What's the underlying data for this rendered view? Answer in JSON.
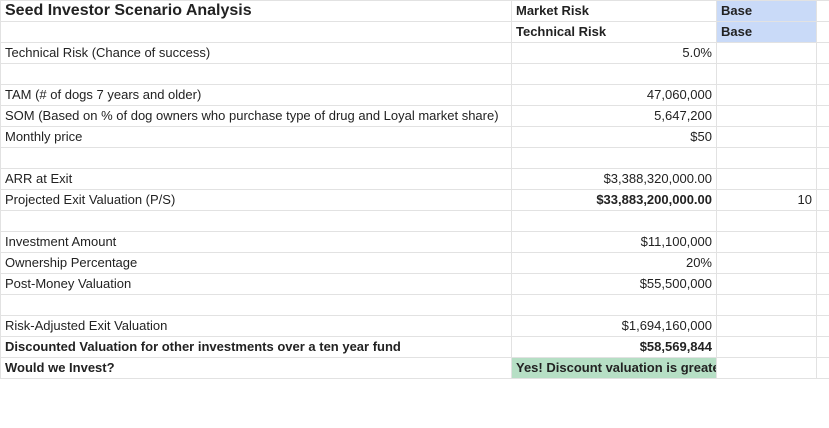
{
  "title": "Seed Investor Scenario Analysis",
  "scenario": {
    "market_risk_label": "Market Risk",
    "market_risk_value": "Base",
    "technical_risk_label": "Technical Risk",
    "technical_risk_value": "Base"
  },
  "rows": {
    "tech_risk": {
      "label": "Technical Risk (Chance of success)",
      "value": "5.0%"
    },
    "tam": {
      "label": "TAM (# of dogs 7 years and older)",
      "value": "47,060,000"
    },
    "som": {
      "label": "SOM (Based on % of dog owners who purchase type of drug and Loyal market share)",
      "value": "5,647,200"
    },
    "monthly_price": {
      "label": "Monthly price",
      "value": "$50"
    },
    "arr": {
      "label": "ARR at Exit",
      "value": "$3,388,320,000.00"
    },
    "exit_valuation": {
      "label": "Projected Exit Valuation (P/S)",
      "value": "$33,883,200,000.00",
      "multiple": "10"
    },
    "investment": {
      "label": "Investment Amount",
      "value": "$11,100,000"
    },
    "ownership": {
      "label": "Ownership Percentage",
      "value": "20%"
    },
    "post_money": {
      "label": "Post-Money Valuation",
      "value": "$55,500,000"
    },
    "risk_adjusted": {
      "label": "Risk-Adjusted Exit Valuation",
      "value": "$1,694,160,000"
    },
    "discounted": {
      "label": "Discounted Valuation for other investments over a ten year fund",
      "value": "$58,569,844"
    },
    "invest": {
      "label": "Would we Invest?",
      "value": "Yes! Discount valuation is greater than current post-money valuation."
    }
  },
  "colors": {
    "scenario_fill": "#c9daf8",
    "verdict_fill": "#b6dfc5"
  }
}
